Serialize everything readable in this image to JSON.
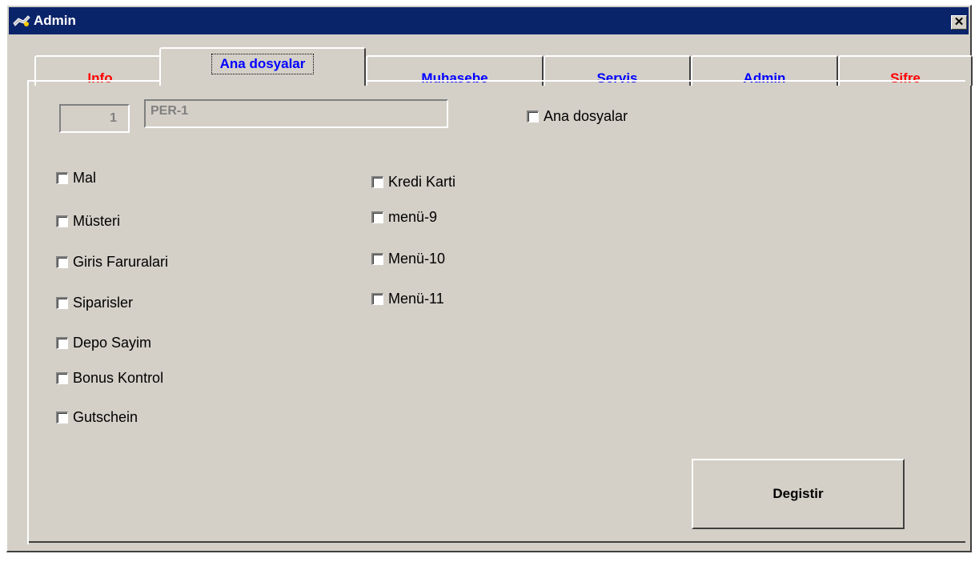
{
  "window": {
    "title": "Admin",
    "close_label": "✕"
  },
  "tabs": [
    {
      "label": "Info",
      "color": "#ff0000",
      "active": false
    },
    {
      "label": "Ana dosyalar",
      "color": "#0000ff",
      "active": true
    },
    {
      "label": "Muhasebe",
      "color": "#0000ff",
      "active": false
    },
    {
      "label": "Servis",
      "color": "#0000ff",
      "active": false
    },
    {
      "label": "Admin",
      "color": "#0000ff",
      "active": false
    },
    {
      "label": "Sifre",
      "color": "#ff0000",
      "active": false
    }
  ],
  "form": {
    "number_value": "1",
    "name_value": "PER-1",
    "group_checkbox_label": "Ana dosyalar"
  },
  "left_checkboxes": [
    {
      "label": "Mal",
      "checked": false
    },
    {
      "label": "Müsteri",
      "checked": false
    },
    {
      "label": "Giris Faruralari",
      "checked": false
    },
    {
      "label": "Siparisler",
      "checked": false
    },
    {
      "label": "Depo Sayim",
      "checked": false
    },
    {
      "label": "Bonus Kontrol",
      "checked": false
    },
    {
      "label": "Gutschein",
      "checked": false
    }
  ],
  "right_checkboxes": [
    {
      "label": "Kredi Karti",
      "checked": false
    },
    {
      "label": "menü-9",
      "checked": false
    },
    {
      "label": "Menü-10",
      "checked": false
    },
    {
      "label": "Menü-11",
      "checked": false
    }
  ],
  "actions": {
    "save_label": "Degistir"
  },
  "colors": {
    "titlebar": "#0a246a",
    "face": "#d4d0c8",
    "tab_red": "#ff0000",
    "tab_blue": "#0000ff"
  }
}
